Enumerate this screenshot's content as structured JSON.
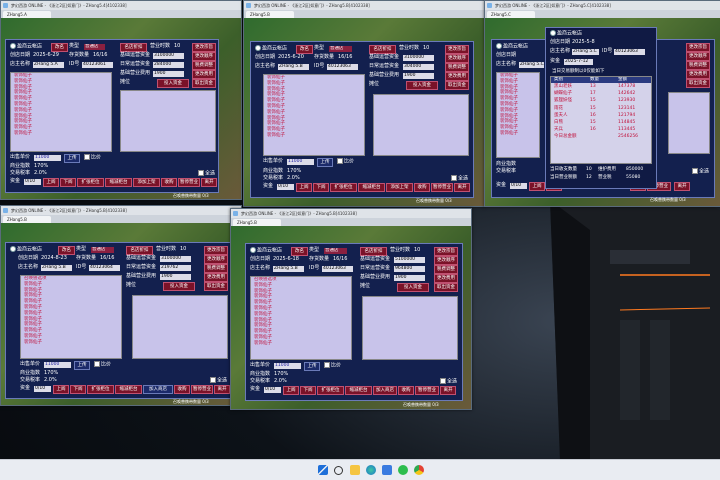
{
  "titles": {
    "w1": "梦幻西游 ONLINE - 《浙江2区|如意门》- ZHang5.4[4102338]",
    "w2": "梦幻西游 ONLINE - 《浙江2区|如意门》- ZHang5.B[4102338]",
    "w3": "梦幻西游 ONLINE - 《浙江2区|如意门》- ZHang5.C[4102338]",
    "w4": "梦幻西游 ONLINE - 《浙江2区|如意门》- ZHang5.B[4102338]",
    "w5": "梦幻西游 ONLINE - 《浙江2区|如意门》- ZHang5.B[4102338]"
  },
  "tabs": {
    "w1": "ZHang5.A",
    "w2": "ZHang5.B",
    "w3": "ZHang5.C",
    "w4": "ZHang5.B",
    "w5": "ZHang5.B"
  },
  "labels": {
    "shop_name": "盈商云帐店",
    "rename": "改名",
    "type": "类型",
    "type_value": "普通店",
    "type_value_b": "普通店",
    "shop_tip": "名店折扣",
    "business_days": "营业时数",
    "open_date": "创店日期",
    "stock_count": "存货数量",
    "owner": "店主名称",
    "id": "ID号",
    "basic_funds": "基础运营资金",
    "daily_funds": "日常运营资金",
    "basic_fee": "基础营业费用",
    "stall": "摊位",
    "upgrade": "更改宗旨",
    "change_order": "更改顺序",
    "invest": "投入资金",
    "withdraw": "取出资金",
    "fee_set": "税费调整",
    "fee_use": "更改费用",
    "price": "出售单价",
    "compare": "比价",
    "deal": "上传",
    "rate": "商业指数",
    "tax": "交易税率",
    "range": "范围",
    "select_all": "全选",
    "pay": "资金",
    "up": "上阅",
    "down": "下阅",
    "expand": "扩张柜位",
    "shrink": "缩减柜台",
    "add": "加入商店",
    "collect": "收购",
    "stop": "暂停营业",
    "leave": "离开",
    "ach": "召唤兽携带数量",
    "up2": "上阅",
    "down2": "下阅",
    "extend": "扩张柜位",
    "shrink2": "缩减柜台",
    "add2": "添加上架",
    "next_open": "出售登记",
    "next_close": "出售登记"
  },
  "w1": {
    "day": "2025-6-29",
    "stock": "16/16",
    "owner": "ZHang 5.A",
    "id": "40123061",
    "basic": "3100000",
    "daily": "284000",
    "fee": "1900",
    "hours": "10",
    "items": [
      "装饰仙子",
      "装饰仙子",
      "装饰仙子",
      "装饰仙子",
      "装饰仙子",
      "装饰仙子",
      "装饰仙子",
      "装饰仙子",
      "装饰仙子",
      "装饰仙子",
      "装饰仙子"
    ],
    "price_val": "11000",
    "rate_val": "170%",
    "tax_val": "2.0%",
    "range_val": "0/10",
    "count": "0/3"
  },
  "w2": {
    "day": "2025-6-20",
    "stock": "16/16",
    "owner": "ZHang 5.B",
    "id": "40123063",
    "basic": "3100000",
    "daily": "304000",
    "fee": "1900",
    "hours": "10",
    "items": [
      "装饰仙子",
      "装饰仙子",
      "装饰仙子",
      "装饰仙子",
      "装饰仙子",
      "装饰仙子",
      "装饰仙子",
      "装饰仙子",
      "装饰仙子",
      "装饰仙子",
      "装饰仙子"
    ],
    "price_val": "11000",
    "rate_val": "170%",
    "tax_val": "2.0%",
    "range_val": "0/10",
    "count": "0/3"
  },
  "w3": {
    "day": "2025-5-6",
    "stock": "16/16",
    "owner": "ZHang 5.C",
    "id": "40123063",
    "hours": "10",
    "items": [
      "装饰仙子",
      "装饰仙子",
      "装饰仙子",
      "装饰仙子",
      "装饰仙子",
      "装饰仙子",
      "装饰仙子",
      "装饰仙子",
      "装饰仙子",
      "装饰仙子",
      "装饰仙子"
    ],
    "today_income": "850000",
    "today_expense": "55080",
    "range_val": "0/10",
    "count": "0/3",
    "popup": {
      "title": "盈商云帐店",
      "day": "2025-5-8",
      "id": "40123063",
      "owner": "ZHang 5.C",
      "date_label": "2025-7-12",
      "hint": "当日交易额制以0仅能如下",
      "cols": [
        "类别",
        "数量",
        "金额"
      ],
      "rows": [
        [
          "黑山老妖",
          "13",
          "147378"
        ],
        [
          "蝴蝶仙子",
          "17",
          "142642"
        ],
        [
          "狐狸妖怪",
          "15",
          "123930"
        ],
        [
          "雨花",
          "15",
          "123141"
        ],
        [
          "蛋夫人",
          "16",
          "121794"
        ],
        [
          "白熊",
          "15",
          "114845"
        ],
        [
          "天兵",
          "16",
          "113445"
        ],
        [
          "今日总金额",
          "",
          "2546256"
        ]
      ],
      "foot1": "当日收支数量",
      "foot1v": "10",
      "foot1b": "维护费用",
      "foot1bv": "850000",
      "foot2": "当日营业税额",
      "foot2v": "12",
      "foot2b": "营业税",
      "foot2bv": "55080"
    }
  },
  "w4": {
    "day": "2024-8-23",
    "stock": "16/16",
    "owner": "ZHang 5.B",
    "id": "40123064",
    "basic": "3100000",
    "daily": "219762",
    "fee": "1900",
    "hours": "10",
    "items": [
      "召唤兽选项",
      "装饰仙子",
      "装饰仙子",
      "装饰仙子",
      "装饰仙子",
      "装饰仙子",
      "装饰仙子",
      "装饰仙子",
      "装饰仙子",
      "装饰仙子",
      "装饰仙子",
      "装饰仙子"
    ],
    "price_val": "11000",
    "rate_val": "170%",
    "tax_val": "2.0%",
    "range_val": "0/10",
    "count": "0/3"
  },
  "w5": {
    "day": "2025-6-18",
    "stock": "16/16",
    "owner": "ZHang 5.B",
    "id": "40123063",
    "basic": "5100000",
    "daily": "964800",
    "fee": "1900",
    "hours": "10",
    "items": [
      "召唤兽选项",
      "装饰仙子",
      "装饰仙子",
      "装饰仙子",
      "装饰仙子",
      "装饰仙子",
      "装饰仙子",
      "装饰仙子",
      "装饰仙子",
      "装饰仙子",
      "装饰仙子",
      "装饰仙子"
    ],
    "price_val": "11000",
    "rate_val": "170%",
    "tax_val": "2.0%",
    "range_val": "0/10",
    "count": "0/3"
  },
  "icons": [
    "windows-start-icon",
    "search-icon",
    "explorer-icon",
    "edge-icon",
    "store-icon",
    "wechat-icon",
    "chrome-icon"
  ],
  "colors": {
    "panel": "#13204e",
    "button_red": "#7a1228",
    "list_bg": "#c8c3ea",
    "item_text": "#c0103a"
  }
}
